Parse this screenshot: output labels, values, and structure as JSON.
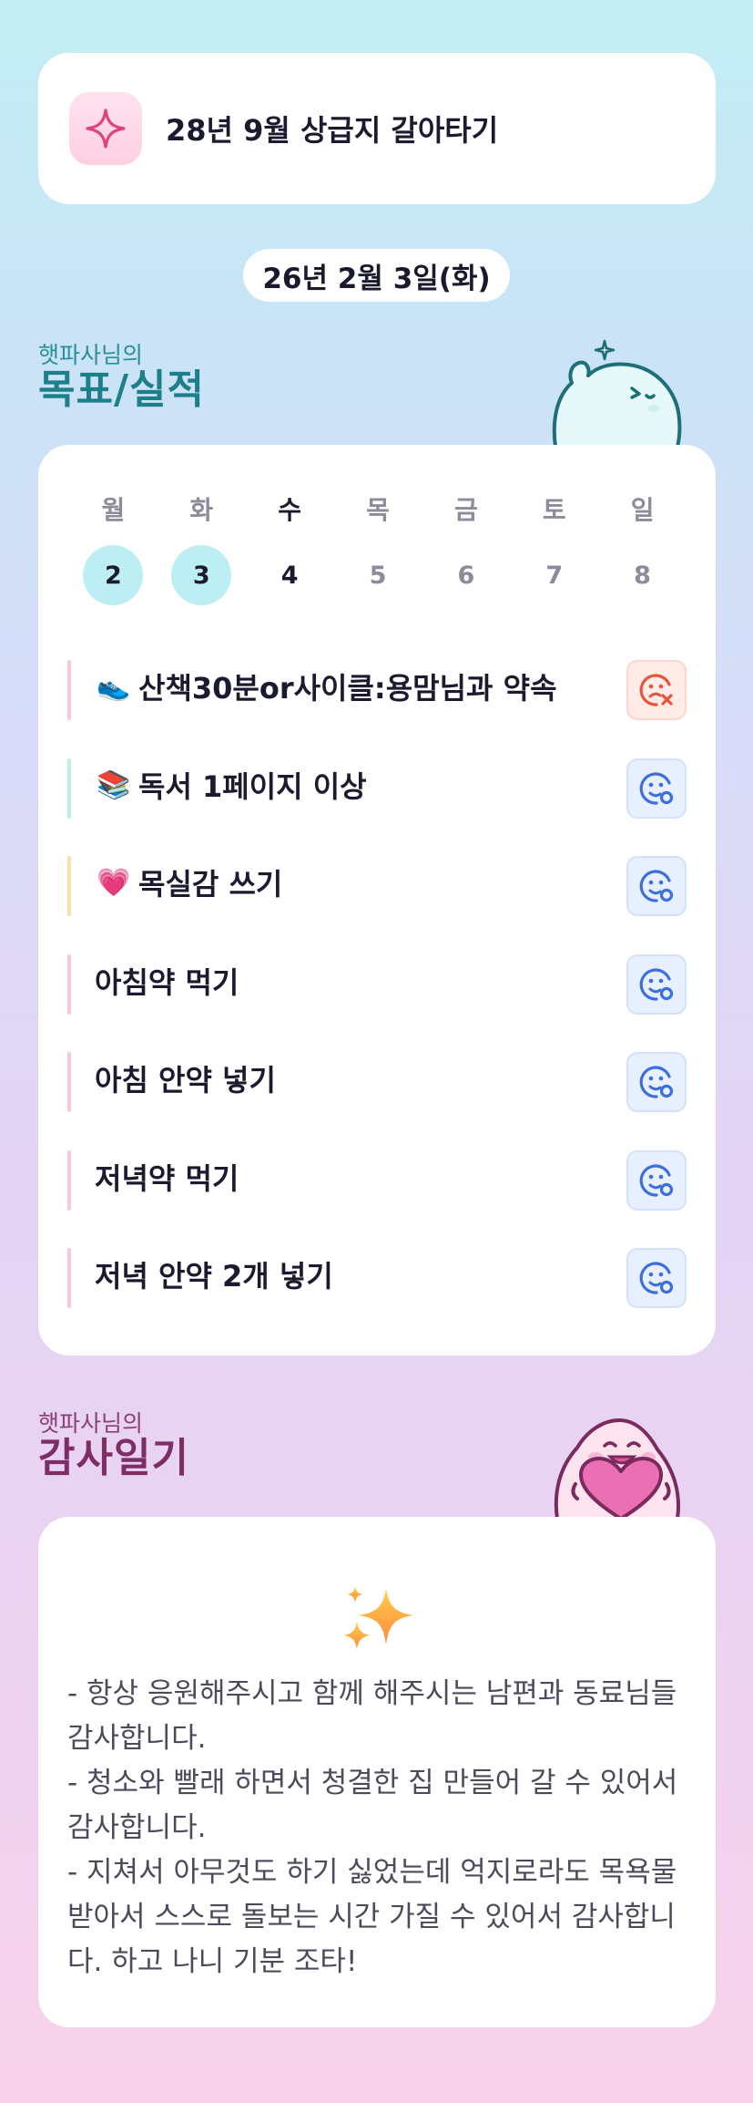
{
  "goal": {
    "icon": "sparkle-icon",
    "text": "28년 9월 상급지 갈아타기"
  },
  "date": "26년 2월 3일(화)",
  "goals_section": {
    "small": "햇파사님의",
    "big": "목표/실적"
  },
  "week": [
    {
      "day": "월",
      "num": "2",
      "state": "done"
    },
    {
      "day": "화",
      "num": "3",
      "state": "done"
    },
    {
      "day": "수",
      "num": "4",
      "state": "current"
    },
    {
      "day": "목",
      "num": "5",
      "state": "future"
    },
    {
      "day": "금",
      "num": "6",
      "state": "future"
    },
    {
      "day": "토",
      "num": "7",
      "state": "future"
    },
    {
      "day": "일",
      "num": "8",
      "state": "future"
    }
  ],
  "tasks": [
    {
      "emoji": "👟",
      "label": "산책30분or사이클:용맘님과 약속",
      "status": "fail",
      "bar_color": "#f7c8dc"
    },
    {
      "emoji": "📚",
      "label": "독서 1페이지 이상",
      "status": "ok",
      "bar_color": "#bff0e0"
    },
    {
      "emoji": "💗",
      "label": "목실감 쓰기",
      "status": "ok",
      "bar_color": "#f7e2a8"
    },
    {
      "emoji": "",
      "label": "아침약 먹기",
      "status": "ok",
      "bar_color": "#f7c8dc"
    },
    {
      "emoji": "",
      "label": "아침 안약 넣기",
      "status": "ok",
      "bar_color": "#f7c8dc"
    },
    {
      "emoji": "",
      "label": "저녁약 먹기",
      "status": "ok",
      "bar_color": "#f7c8dc"
    },
    {
      "emoji": "",
      "label": "저녁 안약 2개 넣기",
      "status": "ok",
      "bar_color": "#f7c8dc"
    }
  ],
  "diary_section": {
    "small": "햇파사님의",
    "big": "감사일기"
  },
  "diary": {
    "icon": "sparkles-icon",
    "text": "- 항상 응원해주시고 함께 해주시는 남편과 동료님들 감사합니다.\n- 청소와 빨래 하면서 청결한 집 만들어 갈 수 있어서 감사합니다.\n- 지쳐서 아무것도 하기 싫었는데 억지로라도 목욕물 받아서 스스로 돌보는 시간 가질 수 있어서 감사합니다. 하고 나니 기분 조타!"
  },
  "colors": {
    "teal": "#1d7f8a",
    "plum": "#7f2d67",
    "ok": "#3b6fe0",
    "fail": "#e8553a"
  }
}
